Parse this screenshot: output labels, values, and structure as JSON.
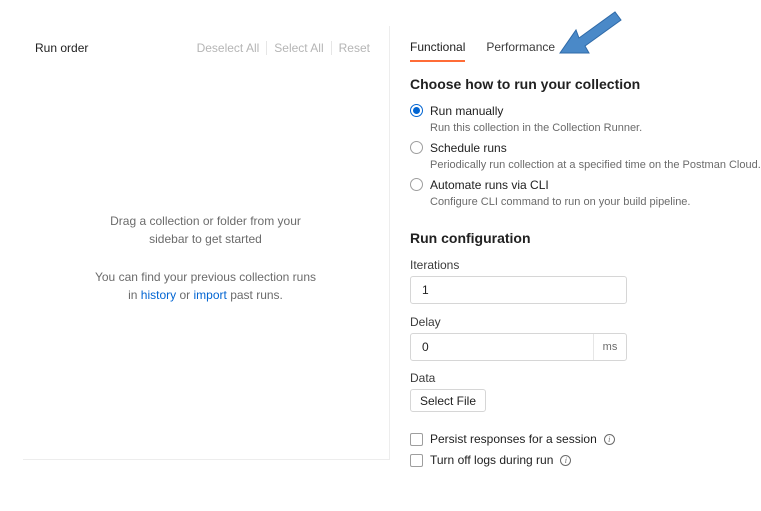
{
  "left": {
    "title": "Run order",
    "actions": [
      "Deselect All",
      "Select All",
      "Reset"
    ],
    "empty_line1": "Drag a collection or folder from your",
    "empty_line2": "sidebar to get started",
    "history_line1": "You can find your previous collection runs",
    "history_prefix": "in",
    "history_link": "history",
    "history_or": "or",
    "import_link": "import",
    "history_suffix": "past runs."
  },
  "tabs": [
    {
      "label": "Functional",
      "active": true
    },
    {
      "label": "Performance",
      "active": false
    }
  ],
  "choose": {
    "title": "Choose how to run your collection",
    "options": [
      {
        "label": "Run manually",
        "desc": "Run this collection in the Collection Runner.",
        "selected": true
      },
      {
        "label": "Schedule runs",
        "desc": "Periodically run collection at a specified time on the Postman Cloud.",
        "selected": false
      },
      {
        "label": "Automate runs via CLI",
        "desc": "Configure CLI command to run on your build pipeline.",
        "selected": false
      }
    ]
  },
  "config": {
    "title": "Run configuration",
    "iterations_label": "Iterations",
    "iterations_value": "1",
    "delay_label": "Delay",
    "delay_value": "0",
    "delay_unit": "ms",
    "data_label": "Data",
    "select_file": "Select File",
    "persist_label": "Persist responses for a session",
    "logs_label": "Turn off logs during run",
    "info_glyph": "i"
  },
  "colors": {
    "accent_tab": "#ff6c37",
    "radio_selected": "#0265d2",
    "link": "#0265d2",
    "arrow": "#4a89c8"
  }
}
